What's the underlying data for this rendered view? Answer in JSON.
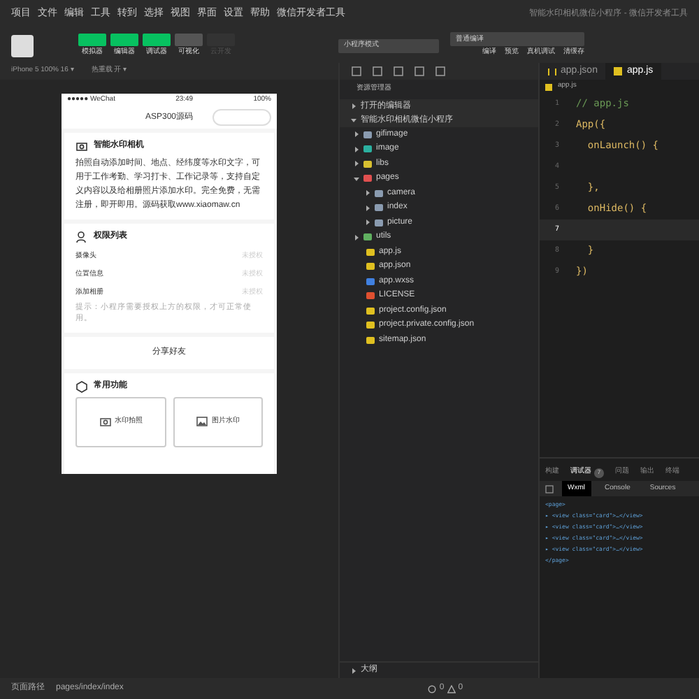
{
  "menu": [
    "项目",
    "文件",
    "编辑",
    "工具",
    "转到",
    "选择",
    "视图",
    "界面",
    "设置",
    "帮助",
    "微信开发者工具"
  ],
  "window": {
    "title": "智能水印相机微信小程序 - 微信开发者工具"
  },
  "toolbar": {
    "views": [
      {
        "label": "模拟器",
        "selected": true,
        "disabled": false
      },
      {
        "label": "编辑器",
        "selected": true,
        "disabled": false
      },
      {
        "label": "调试器",
        "selected": true,
        "disabled": false
      },
      {
        "label": "可视化",
        "selected": false,
        "disabled": false
      },
      {
        "label": "云开发",
        "selected": false,
        "disabled": true
      }
    ],
    "mode": "小程序模式",
    "compile": "普通编译",
    "actions": [
      "编译",
      "预览",
      "真机调试",
      "清缓存"
    ]
  },
  "simulator_bar": {
    "device": "iPhone 5 100% 16 ▾",
    "hot_reload": "热重载 开 ▾"
  },
  "phone": {
    "carrier": "●●●●● WeChat",
    "time": "23:49",
    "battery": "100%",
    "nav_title": "ASP300源码",
    "intro": {
      "title": "智能水印相机",
      "text": "拍照自动添加时间、地点、经纬度等水印文字，可用于工作考勤、学习打卡、工作记录等，支持自定义内容以及给相册照片添加水印。完全免费，无需注册，即开即用。源码获取www.xiaomaw.cn"
    },
    "permissions": {
      "title": "权限列表",
      "rows": [
        {
          "label": "摄像头",
          "status": "未授权"
        },
        {
          "label": "位置信息",
          "status": "未授权"
        },
        {
          "label": "添加相册",
          "status": "未授权"
        }
      ],
      "note": "提示：小程序需要授权上方的权限，才可正常使用。"
    },
    "share": "分享好友",
    "features": {
      "title": "常用功能",
      "buttons": [
        {
          "label": "水印拍照",
          "kind": "camera"
        },
        {
          "label": "图片水印",
          "kind": "image"
        }
      ]
    }
  },
  "explorer": {
    "title": "资源管理器",
    "open_editors": "打开的编辑器",
    "project": "智能水印相机微信小程序",
    "tree": [
      {
        "name": "gifimage",
        "kind": "folder",
        "color": "#8a9bb0",
        "expanded": false
      },
      {
        "name": "image",
        "kind": "folder",
        "color": "#2bb0a0",
        "expanded": false
      },
      {
        "name": "libs",
        "kind": "folder",
        "color": "#d8c030",
        "expanded": false
      },
      {
        "name": "pages",
        "kind": "folder",
        "color": "#e05050",
        "expanded": true,
        "children": [
          {
            "name": "camera",
            "kind": "folder",
            "color": "#8a9bb0",
            "expanded": false
          },
          {
            "name": "index",
            "kind": "folder",
            "color": "#8a9bb0",
            "expanded": false
          },
          {
            "name": "picture",
            "kind": "folder",
            "color": "#8a9bb0",
            "expanded": false
          }
        ]
      },
      {
        "name": "utils",
        "kind": "folder",
        "color": "#60b060",
        "expanded": false
      },
      {
        "name": "app.js",
        "kind": "js",
        "color": "#e0c020"
      },
      {
        "name": "app.json",
        "kind": "json",
        "color": "#e0c020"
      },
      {
        "name": "app.wxss",
        "kind": "wxss",
        "color": "#4080e0"
      },
      {
        "name": "LICENSE",
        "kind": "license",
        "color": "#e05030"
      },
      {
        "name": "project.config.json",
        "kind": "json",
        "color": "#e0c020"
      },
      {
        "name": "project.private.config.json",
        "kind": "json",
        "color": "#e0c020"
      },
      {
        "name": "sitemap.json",
        "kind": "json",
        "color": "#e0c020"
      }
    ]
  },
  "editor": {
    "tabs": [
      {
        "label": "app.json",
        "kind": "json",
        "selected": false
      },
      {
        "label": "app.js",
        "kind": "js",
        "selected": true
      }
    ],
    "breadcrumb": "app.js",
    "lines": [
      {
        "number": "1",
        "text": "// app.js",
        "kind": "comment",
        "selected": false
      },
      {
        "number": "2",
        "text": "App({",
        "kind": "code",
        "selected": false
      },
      {
        "number": "3",
        "text": "  onLaunch() {",
        "kind": "code",
        "selected": false
      },
      {
        "number": "4",
        "selected": false
      },
      {
        "number": "5",
        "text": "  },",
        "kind": "code",
        "selected": false
      },
      {
        "number": "6",
        "text": "  onHide() {",
        "kind": "code",
        "selected": false
      },
      {
        "number": "7",
        "selected": true
      },
      {
        "number": "8",
        "text": "  }",
        "kind": "code",
        "selected": false
      },
      {
        "number": "9",
        "text": "})",
        "kind": "code",
        "selected": false
      }
    ]
  },
  "devtools": {
    "tabs": [
      {
        "label": "构建",
        "selected": false
      },
      {
        "label": "调试器",
        "selected": true,
        "badge": "7"
      },
      {
        "label": "问题",
        "selected": false
      },
      {
        "label": "输出",
        "selected": false
      },
      {
        "label": "终端",
        "selected": false
      }
    ],
    "subtabs": [
      {
        "label": "Wxml",
        "selected": true
      },
      {
        "label": "Console",
        "selected": false
      },
      {
        "label": "Sources",
        "selected": false
      }
    ],
    "wxml": [
      "<page>",
      "▸ <view class=\"card\">…</view>",
      "▸ <view class=\"card\">…</view>",
      "▸ <view class=\"card\">…</view>",
      "▸ <view class=\"card\">…</view>",
      "</page>"
    ]
  },
  "outline": "大纲",
  "status_bar": {
    "path_label": "页面路径",
    "path": "pages/index/index",
    "errors": "0",
    "warnings": "0"
  }
}
